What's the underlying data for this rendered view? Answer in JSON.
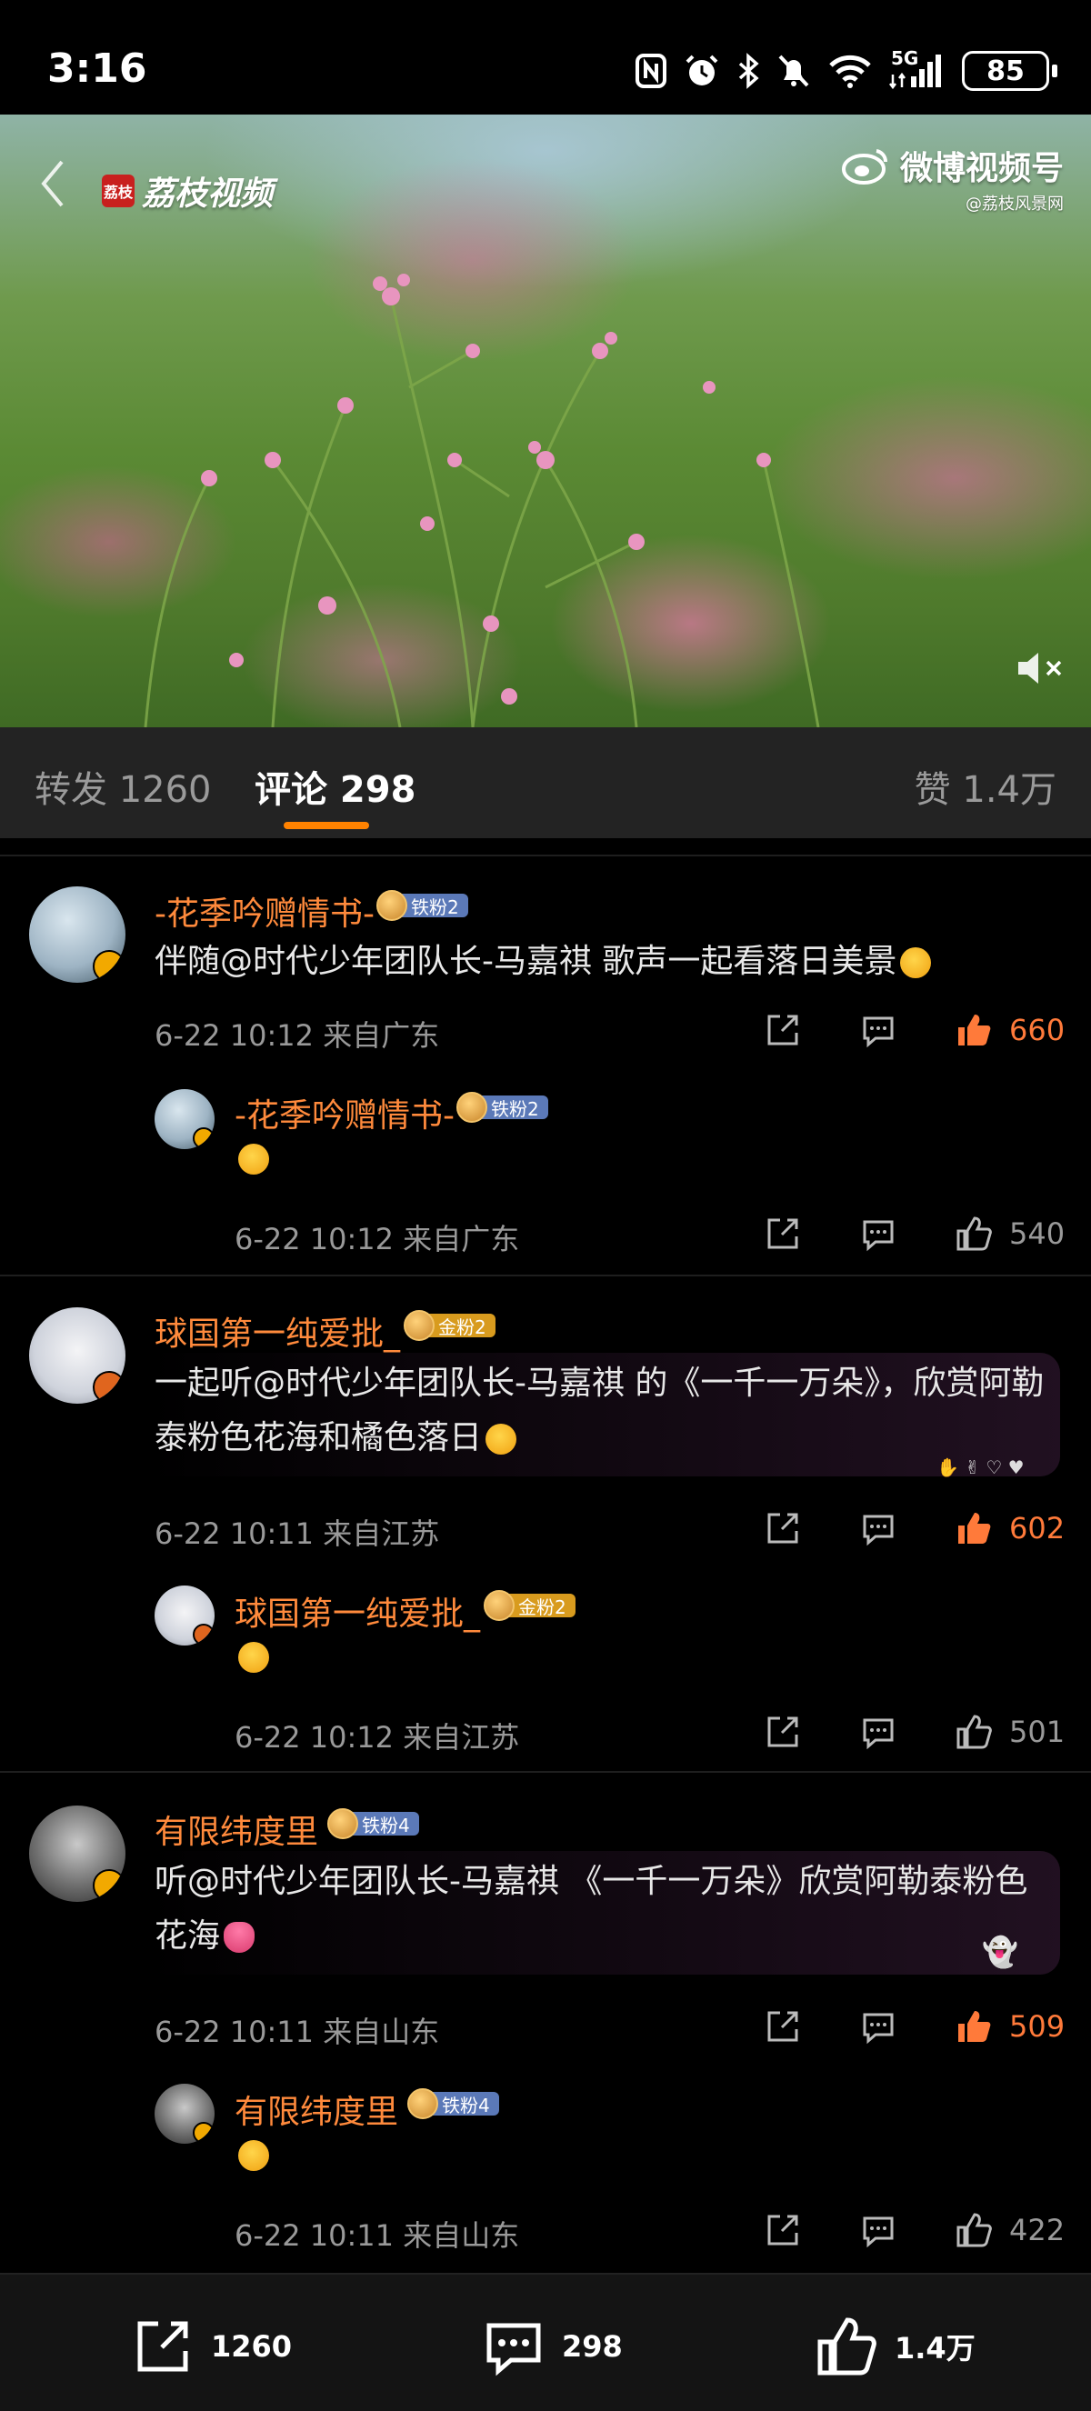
{
  "status": {
    "time": "3:16",
    "network": "5G",
    "battery": "85"
  },
  "video": {
    "logo_left": "荔枝视频",
    "logo_left_mark": "荔枝",
    "logo_right": "微博视频号",
    "logo_right_sub": "@荔枝风景网"
  },
  "tabs": {
    "forward": "转发 1260",
    "comment": "评论 298",
    "like": "赞 1.4万"
  },
  "comments": [
    {
      "user": "-花季吟赠情书-",
      "badge": "铁粉2",
      "badge_type": "iron",
      "text": "伴随@时代少年团队长-马嘉祺 歌声一起看落日美景",
      "time": "6-22 10:12",
      "location": "来自广东",
      "likes": "660",
      "reply": {
        "user": "-花季吟赠情书-",
        "badge": "铁粉2",
        "time": "6-22 10:12",
        "location": "来自广东",
        "likes": "540"
      }
    },
    {
      "user": "球国第一纯爱批_",
      "badge": "金粉2",
      "badge_type": "gold",
      "text_line1": "一起听@时代少年团队长-马嘉祺 的《一千一万朵》，欣赏阿勒",
      "text_line2": "泰粉色花海和橘色落日",
      "time": "6-22 10:11",
      "location": "来自江苏",
      "likes": "602",
      "reply": {
        "user": "球国第一纯爱批_",
        "badge": "金粉2",
        "time": "6-22 10:12",
        "location": "来自江苏",
        "likes": "501"
      }
    },
    {
      "user": "有限纬度里",
      "badge": "铁粉4",
      "badge_type": "iron",
      "text_line1": "听@时代少年团队长-马嘉祺 《一千一万朵》欣赏阿勒泰粉色",
      "text_line2": "花海",
      "time": "6-22 10:11",
      "location": "来自山东",
      "likes": "509",
      "reply": {
        "user": "有限纬度里",
        "badge": "铁粉4",
        "time": "6-22 10:11",
        "location": "来自山东",
        "likes": "422"
      }
    }
  ],
  "bottom": {
    "forward": "1260",
    "comment": "298",
    "like": "1.4万"
  },
  "colors": {
    "accent": "#ff8200",
    "username": "#ff8a3c",
    "like_hot": "#ff7a3a"
  }
}
